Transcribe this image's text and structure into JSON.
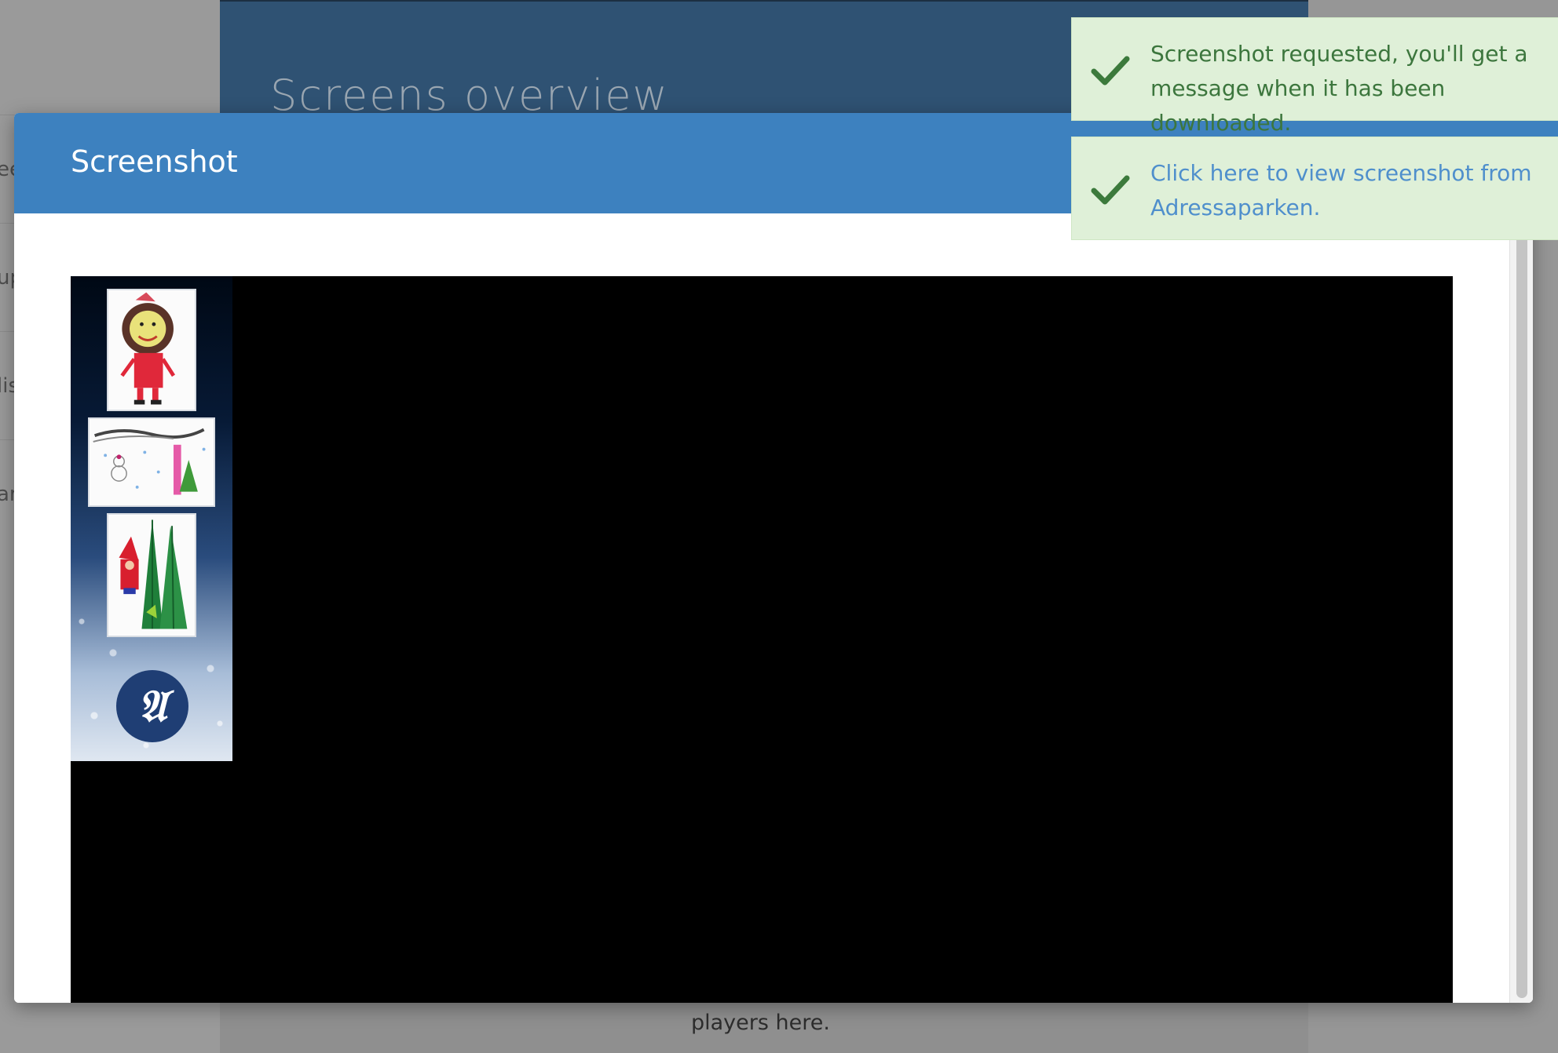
{
  "background": {
    "page_title": "Screens overview",
    "left_items": [
      "ee",
      "up",
      "lis",
      "ar"
    ],
    "bottom_text": "players here."
  },
  "modal": {
    "title": "Screenshot"
  },
  "notifications": [
    {
      "text": "Screenshot requested, you'll get a message when it has been downloaded.",
      "icon": "check-icon"
    },
    {
      "text": "Click here to view screenshot from Adressaparken.",
      "icon": "check-icon"
    }
  ],
  "screenshot": {
    "logo_letter": "𝔄"
  },
  "colors": {
    "modal_header": "#3d81bf",
    "toast_bg": "#dff0d8",
    "toast_text": "#3c763d",
    "toast_link": "#4f8fcc",
    "page_header": "#2f5273"
  }
}
